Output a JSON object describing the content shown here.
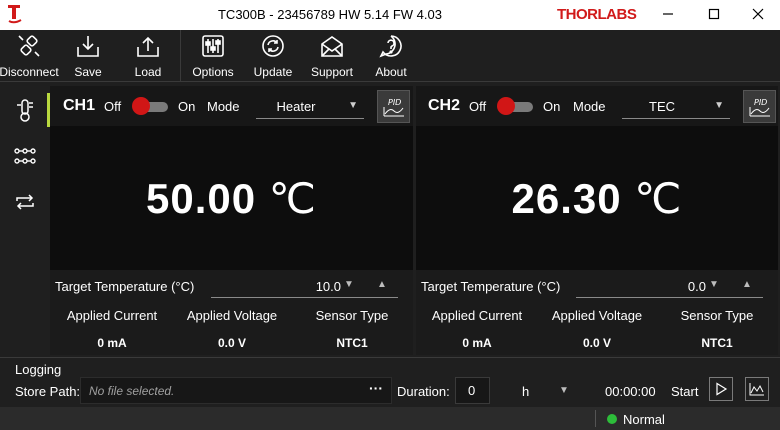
{
  "window": {
    "title": "TC300B - 23456789 HW 5.14 FW 4.03",
    "brand": "THORLABS"
  },
  "toolbar": {
    "disconnect": "Disconnect",
    "save": "Save",
    "load": "Load",
    "options": "Options",
    "update": "Update",
    "support": "Support",
    "about": "About"
  },
  "channels": [
    {
      "name": "CH1",
      "off_label": "Off",
      "on_label": "On",
      "mode_label": "Mode",
      "mode_value": "Heater",
      "pid_label": "PID",
      "temp_value": "50.00",
      "temp_unit": "℃",
      "target_label": "Target Temperature (°C)",
      "target_value": "10.0",
      "applied_current_label": "Applied Current",
      "applied_current_value": "0 mA",
      "applied_voltage_label": "Applied Voltage",
      "applied_voltage_value": "0.0 V",
      "sensor_type_label": "Sensor Type",
      "sensor_type_value": "NTC1"
    },
    {
      "name": "CH2",
      "off_label": "Off",
      "on_label": "On",
      "mode_label": "Mode",
      "mode_value": "TEC",
      "pid_label": "PID",
      "temp_value": "26.30",
      "temp_unit": "℃",
      "target_label": "Target Temperature (°C)",
      "target_value": "0.0",
      "applied_current_label": "Applied Current",
      "applied_current_value": "0 mA",
      "applied_voltage_label": "Applied Voltage",
      "applied_voltage_value": "0.0 V",
      "sensor_type_label": "Sensor Type",
      "sensor_type_value": "NTC1"
    }
  ],
  "logging": {
    "title": "Logging",
    "store_path_label": "Store Path:",
    "store_path_placeholder": "No file selected.",
    "browse_label": "···",
    "duration_label": "Duration:",
    "duration_value": "0",
    "duration_unit": "h",
    "elapsed": "00:00:00",
    "start_label": "Start"
  },
  "status": {
    "state": "Normal",
    "state_color": "#2dbd3a"
  },
  "colors": {
    "accent": "#b9d83f",
    "toggle_off": "#d11616",
    "brand": "#d11a1a"
  }
}
